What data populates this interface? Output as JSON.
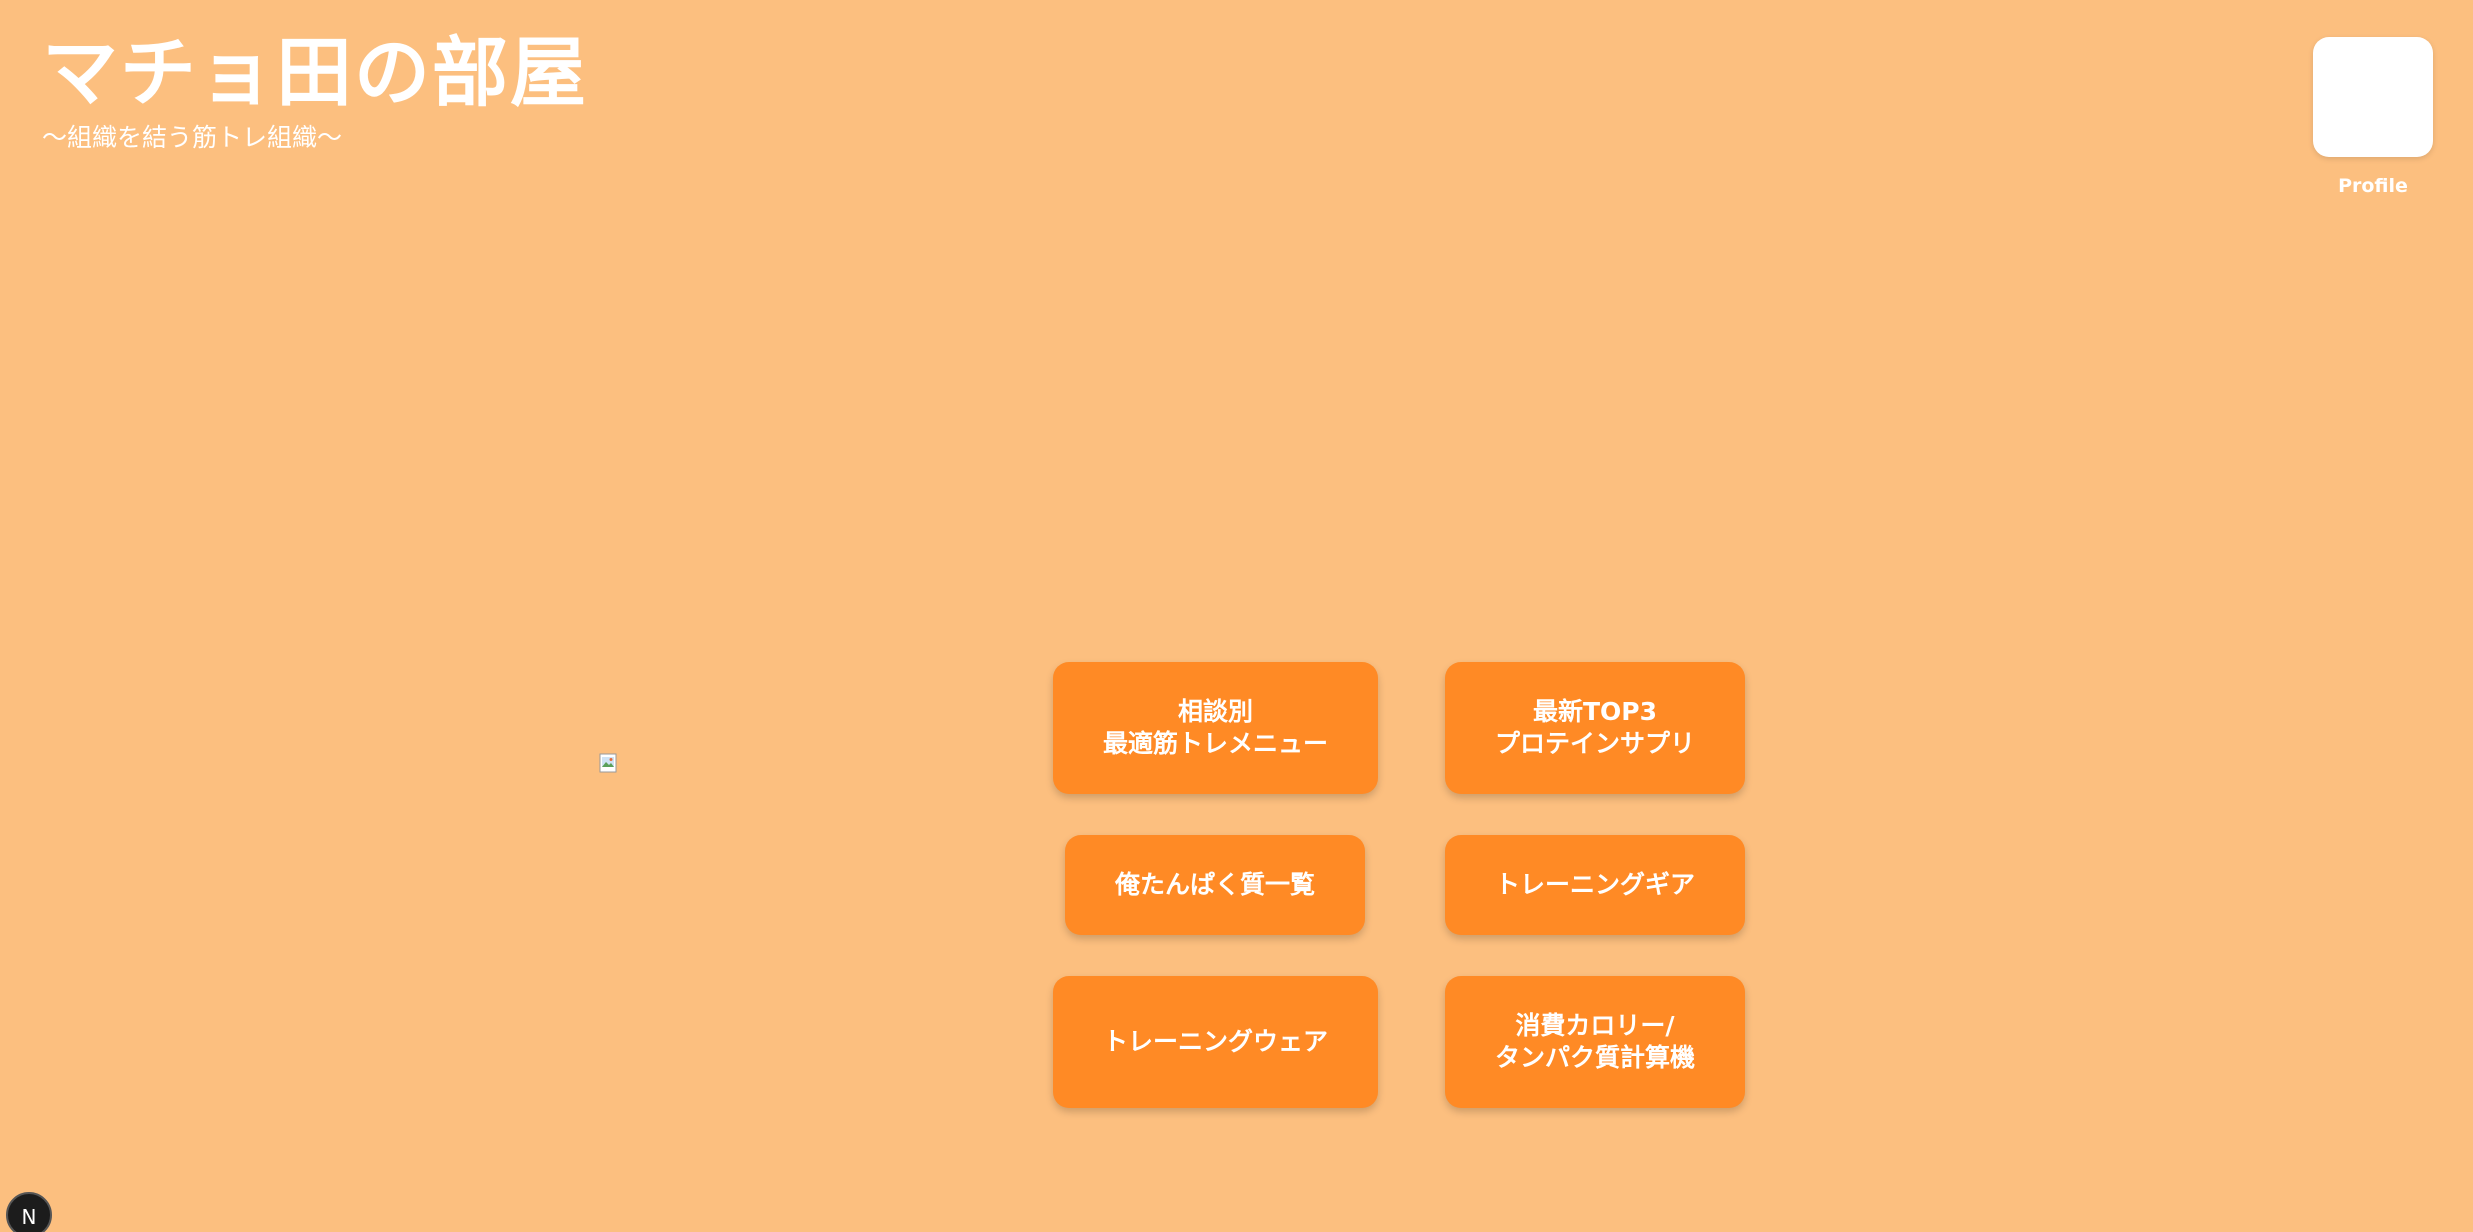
{
  "header": {
    "title": "マチョ田の部屋",
    "subtitle": "〜組織を結う筋トレ組織〜"
  },
  "profile": {
    "label": "Profile"
  },
  "menu": {
    "consult": {
      "line1": "相談別",
      "line2": "最適筋トレメニュー"
    },
    "top3": {
      "line1": "最新TOP3",
      "line2": "プロテインサプリ"
    },
    "protein_list": {
      "label": "俺たんぱく質一覧"
    },
    "gear": {
      "label": "トレーニングギア"
    },
    "wear": {
      "label": "トレーニングウェア"
    },
    "calculator": {
      "line1": "消費カロリー/",
      "line2": "タンパク質計算機"
    }
  },
  "dev_badge": {
    "label": "N"
  },
  "colors": {
    "background": "#fcbf7f",
    "button": "#ff8a25",
    "text": "#ffffff"
  }
}
